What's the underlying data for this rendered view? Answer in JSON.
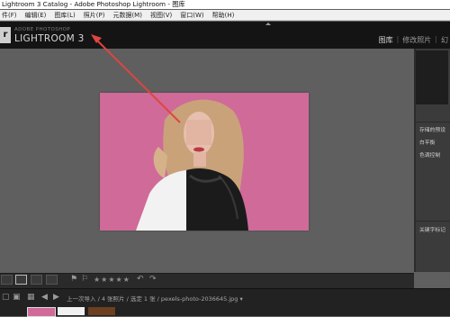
{
  "window": {
    "title": "Lightroom 3 Catalog - Adobe Photoshop Lightroom - 图库"
  },
  "menu": {
    "items": [
      "件(F)",
      "编辑(E)",
      "图库(L)",
      "照片(P)",
      "元数据(M)",
      "视图(V)",
      "窗口(W)",
      "帮助(H)"
    ]
  },
  "header": {
    "logo_mark": "r",
    "logo_sub": "ADOBE PHOTOSHOP",
    "logo_main": "LIGHTROOM 3",
    "modules": [
      "图库",
      "修改照片",
      "幻"
    ]
  },
  "right_panel": {
    "items": [
      "存储的预设",
      "白平衡",
      "色调控制",
      "关键字标记"
    ]
  },
  "toolbar": {
    "stars": "★★★★★"
  },
  "filmstrip": {
    "breadcrumb": "上一次导入 / 4 张照片 / 选定 1 张 / pexels-photo-2036645.jpg ▾"
  },
  "colors": {
    "photo_background": "#d06a99",
    "annotation_arrow": "#e0453e"
  }
}
